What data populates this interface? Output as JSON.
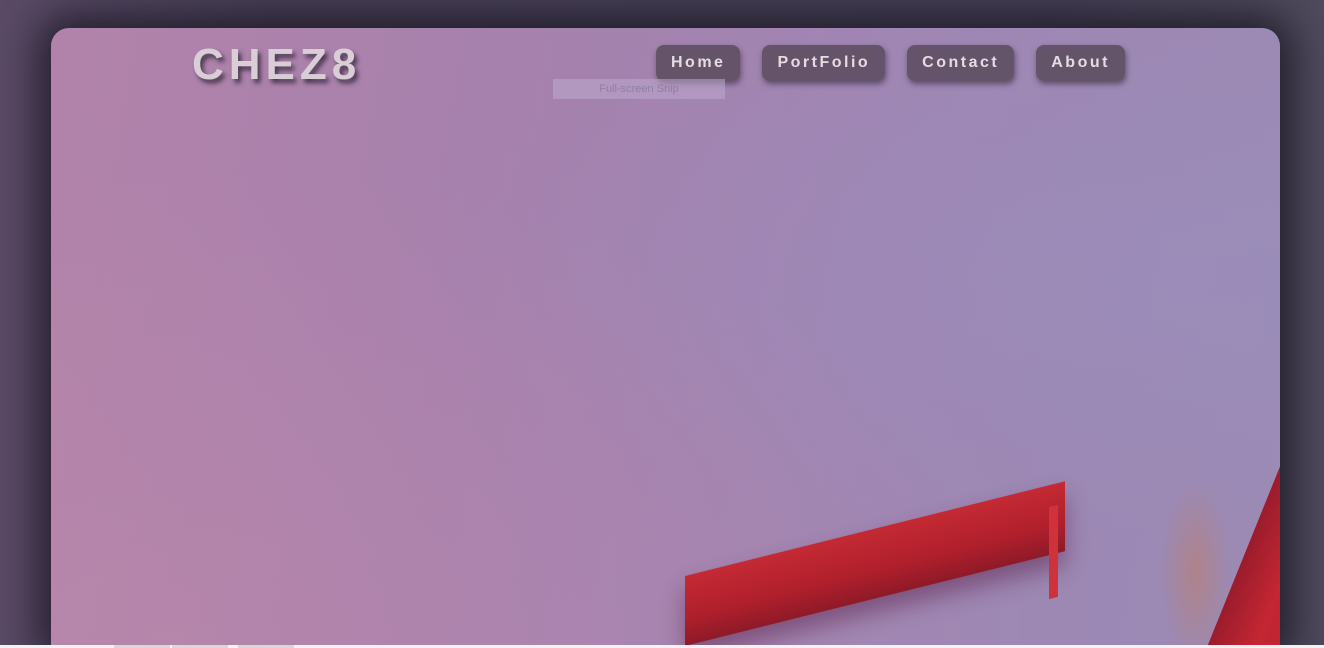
{
  "site": {
    "logo": "CHEZ8"
  },
  "nav": {
    "items": [
      {
        "label": "Home"
      },
      {
        "label": "PortFolio"
      },
      {
        "label": "Contact"
      },
      {
        "label": "About"
      }
    ]
  },
  "overlay": {
    "snip_tooltip": "Full-screen Snip"
  },
  "colors": {
    "hero_gradient_start": "#b283aa",
    "hero_gradient_end": "#9b8ab4",
    "accent_red": "#c42a34",
    "nav_button_bg": "#5c4c60",
    "logo_text": "#d9cdd6"
  }
}
